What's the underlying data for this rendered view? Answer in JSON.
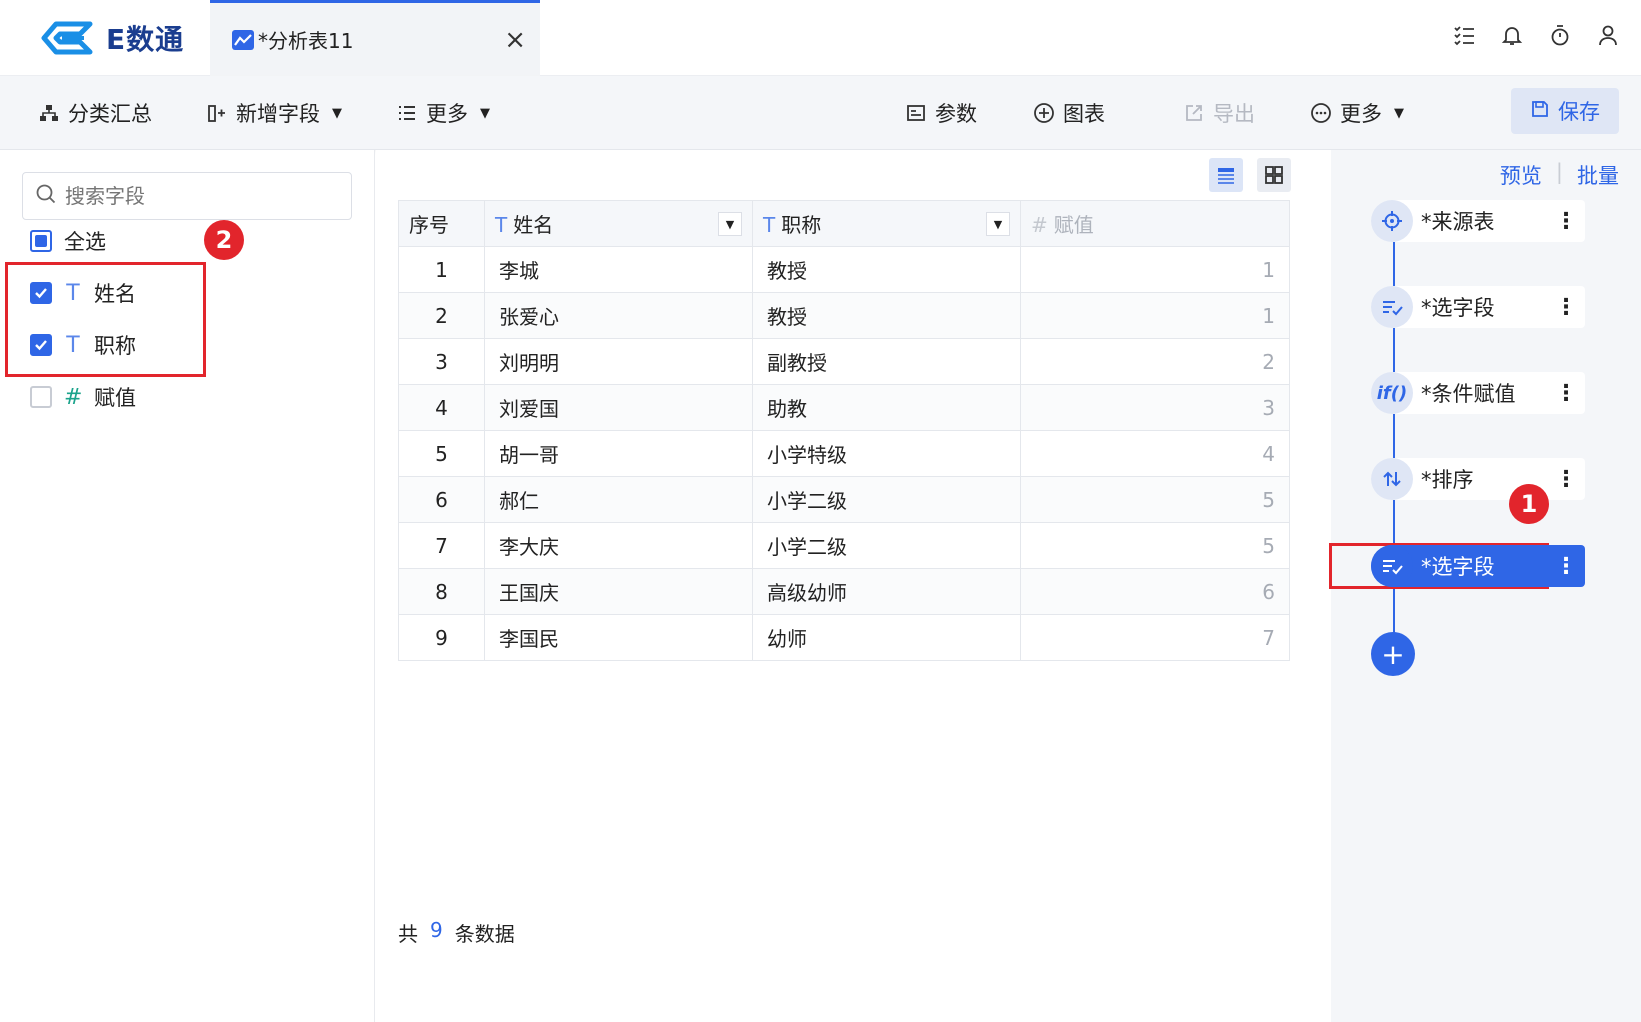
{
  "app": {
    "logo_text": "E数通"
  },
  "tab": {
    "label": "*分析表11",
    "close": "×"
  },
  "toolbar": {
    "group_summary": "分类汇总",
    "add_field": "新增字段",
    "more_left": "更多",
    "params": "参数",
    "chart": "图表",
    "export": "导出",
    "more_right": "更多",
    "save": "保存"
  },
  "left": {
    "search_placeholder": "搜索字段",
    "select_all": "全选",
    "fields": [
      {
        "label": "姓名",
        "type": "T",
        "checked": true
      },
      {
        "label": "职称",
        "type": "T",
        "checked": true
      },
      {
        "label": "赋值",
        "type": "#",
        "checked": false
      }
    ]
  },
  "table": {
    "headers": [
      "序号",
      "姓名",
      "职称",
      "赋值"
    ],
    "header_types": [
      "",
      "T",
      "T",
      "#"
    ],
    "rows": [
      [
        "1",
        "李城",
        "教授",
        "1"
      ],
      [
        "2",
        "张爱心",
        "教授",
        "1"
      ],
      [
        "3",
        "刘明明",
        "副教授",
        "2"
      ],
      [
        "4",
        "刘爱国",
        "助教",
        "3"
      ],
      [
        "5",
        "胡一哥",
        "小学特级",
        "4"
      ],
      [
        "6",
        "郝仁",
        "小学二级",
        "5"
      ],
      [
        "7",
        "李大庆",
        "小学二级",
        "5"
      ],
      [
        "8",
        "王国庆",
        "高级幼师",
        "6"
      ],
      [
        "9",
        "李国民",
        "幼师",
        "7"
      ]
    ],
    "footer_prefix": "共",
    "footer_count": "9",
    "footer_suffix": "条数据"
  },
  "right": {
    "preview": "预览",
    "batch": "批量",
    "steps": [
      {
        "label": "*来源表",
        "icon": "target-icon"
      },
      {
        "label": "*选字段",
        "icon": "select-fields-icon"
      },
      {
        "label": "*条件赋值",
        "icon": "if-icon"
      },
      {
        "label": "*排序",
        "icon": "sort-icon"
      },
      {
        "label": "*选字段",
        "icon": "select-fields-icon",
        "active": true
      }
    ],
    "add": "+"
  },
  "annotations": {
    "badge1": "1",
    "badge2": "2"
  },
  "colors": {
    "accent": "#2f66e6",
    "highlight": "#e2252c"
  }
}
